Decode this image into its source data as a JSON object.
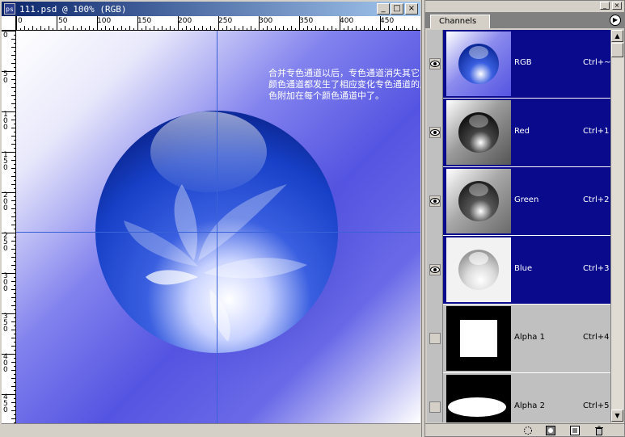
{
  "document": {
    "title": "111.psd @ 100% (RGB)",
    "app_icon": "photoshop-document-icon",
    "window_buttons": {
      "minimize": "_",
      "maximize": "□",
      "close": "×"
    },
    "ruler_top_labels": [
      "0",
      "50",
      "100",
      "150",
      "200",
      "250",
      "300",
      "350",
      "400",
      "450"
    ],
    "ruler_left_labels": [
      "0",
      "50",
      "100",
      "150",
      "200",
      "250",
      "300",
      "350",
      "400",
      "450"
    ],
    "canvas_note": "合并专色通道以后，专色通道消失其它的颜色通道都发生了相应变化专色通道的颜色附加在每个颜色通道中了。"
  },
  "palette": {
    "tab_label": "Channels",
    "menu_icon": "palette-menu-arrow-icon",
    "channels": [
      {
        "name": "RGB",
        "shortcut": "Ctrl+~",
        "visible": true,
        "selected": true,
        "thumb": "rgb"
      },
      {
        "name": "Red",
        "shortcut": "Ctrl+1",
        "visible": true,
        "selected": true,
        "thumb": "gray-dark"
      },
      {
        "name": "Green",
        "shortcut": "Ctrl+2",
        "visible": true,
        "selected": true,
        "thumb": "gray-mid"
      },
      {
        "name": "Blue",
        "shortcut": "Ctrl+3",
        "visible": true,
        "selected": true,
        "thumb": "gray-light"
      },
      {
        "name": "Alpha 1",
        "shortcut": "Ctrl+4",
        "visible": false,
        "selected": false,
        "thumb": "alpha-square"
      },
      {
        "name": "Alpha 2",
        "shortcut": "Ctrl+5",
        "visible": false,
        "selected": false,
        "thumb": "alpha-ellipse"
      }
    ],
    "footer_icons": [
      "load-selection-icon",
      "save-selection-icon",
      "new-channel-icon",
      "trash-icon"
    ]
  },
  "colors": {
    "selection": "#0a0a8c",
    "canvas_blue": "#5454e2",
    "guide": "#3a62d8"
  }
}
